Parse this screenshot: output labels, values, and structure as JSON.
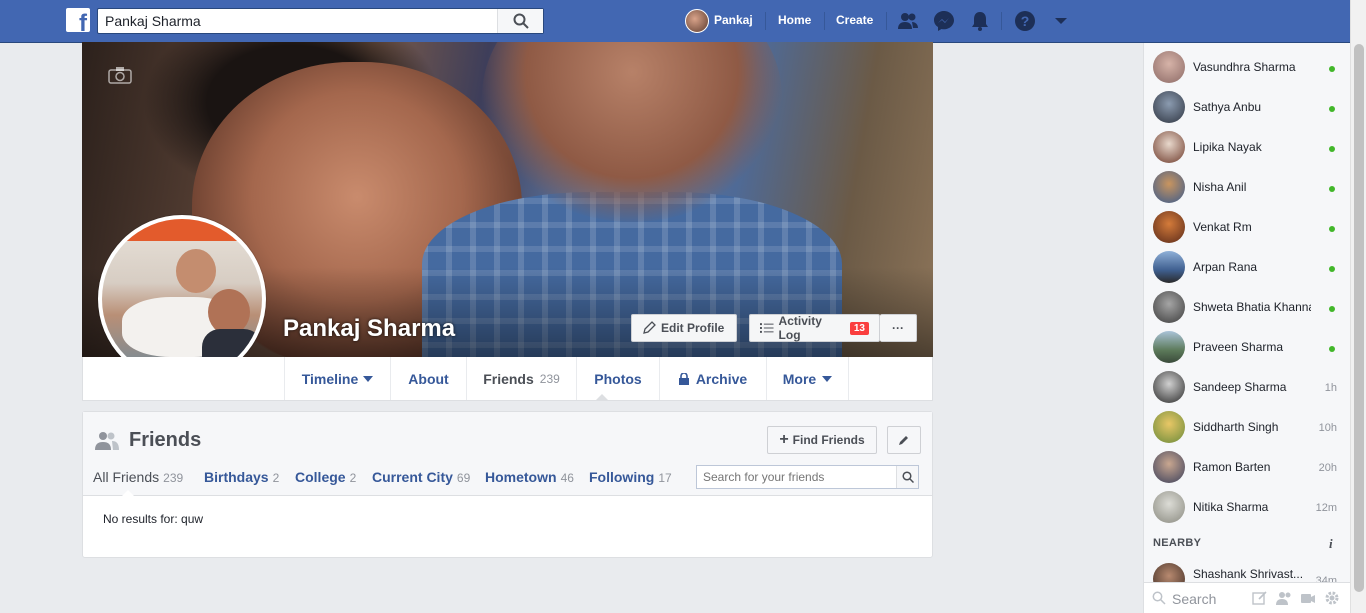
{
  "topbar": {
    "search_value": "Pankaj Sharma",
    "user_name": "Pankaj",
    "home_label": "Home",
    "create_label": "Create",
    "brand_color": "#4267b2"
  },
  "profile": {
    "name": "Pankaj Sharma",
    "edit_profile_label": "Edit Profile",
    "activity_log_label": "Activity Log",
    "activity_log_count": "13",
    "more_label": "···"
  },
  "tabs": [
    {
      "label": "Timeline"
    },
    {
      "label": "About"
    },
    {
      "label": "Friends",
      "count": "239"
    },
    {
      "label": "Photos"
    },
    {
      "label": "Archive"
    },
    {
      "label": "More"
    }
  ],
  "friends": {
    "title": "Friends",
    "find_friends_label": "Find Friends",
    "search_placeholder": "Search for your friends",
    "no_results": "No results for: quw",
    "subtabs": [
      {
        "label": "All Friends",
        "count": "239"
      },
      {
        "label": "Birthdays",
        "count": "2"
      },
      {
        "label": "College",
        "count": "2"
      },
      {
        "label": "Current City",
        "count": "69"
      },
      {
        "label": "Hometown",
        "count": "46"
      },
      {
        "label": "Following",
        "count": "17"
      }
    ]
  },
  "chat": {
    "contacts": [
      {
        "name": "Vasundhra Sharma",
        "status": "online"
      },
      {
        "name": "Sathya Anbu",
        "status": "online"
      },
      {
        "name": "Lipika Nayak",
        "status": "online"
      },
      {
        "name": "Nisha Anil",
        "status": "online"
      },
      {
        "name": "Venkat Rm",
        "status": "online"
      },
      {
        "name": "Arpan Rana",
        "status": "online"
      },
      {
        "name": "Shweta Bhatia Khanna",
        "status": "online"
      },
      {
        "name": "Praveen Sharma",
        "status": "online"
      },
      {
        "name": "Sandeep Sharma",
        "time": "1h"
      },
      {
        "name": "Siddharth Singh",
        "time": "10h"
      },
      {
        "name": "Ramon Barten",
        "time": "20h"
      },
      {
        "name": "Nitika Sharma",
        "time": "12m"
      }
    ],
    "nearby_label": "NEARBY",
    "nearby": [
      {
        "name": "Shashank Shrivast...",
        "time": "34m"
      }
    ],
    "search_placeholder": "Search",
    "online_color": "#42b72a"
  }
}
